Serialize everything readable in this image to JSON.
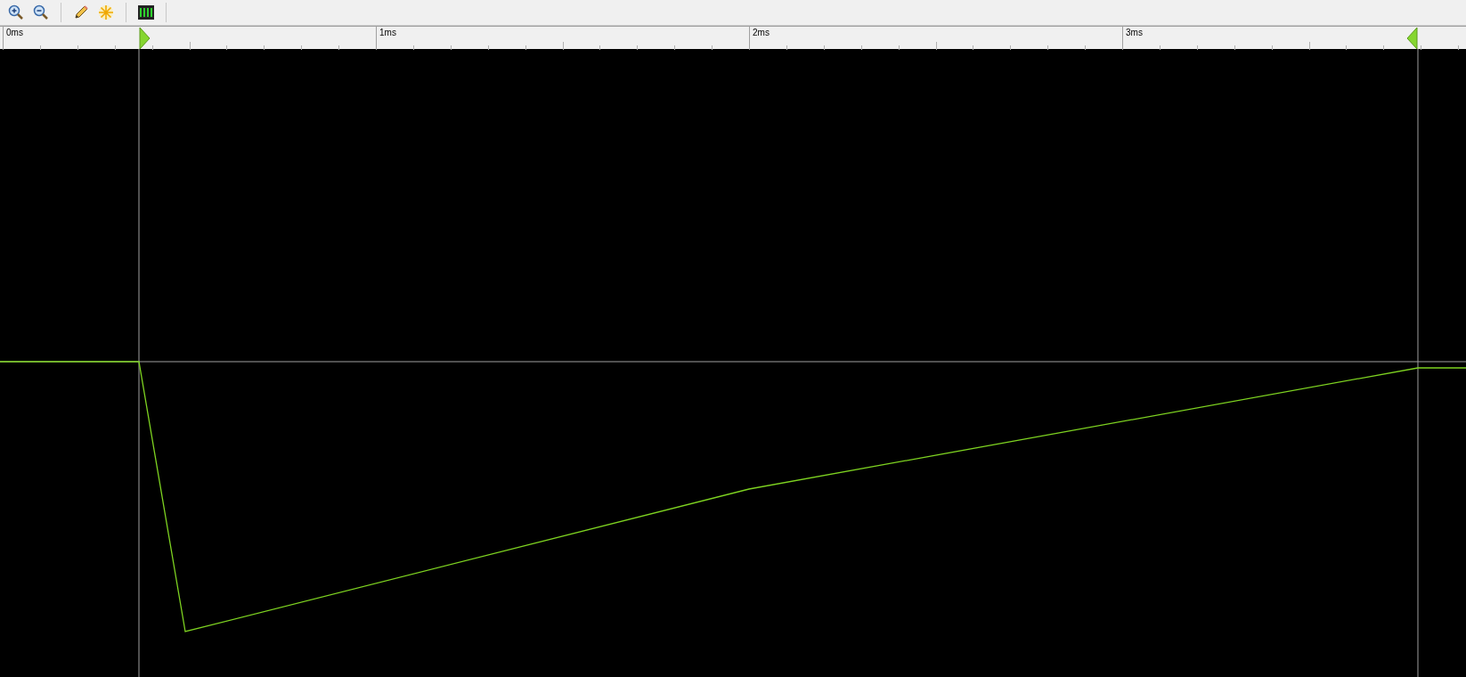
{
  "ruler": {
    "labels": [
      "0ms",
      "1ms",
      "2ms",
      "3ms"
    ]
  }
}
